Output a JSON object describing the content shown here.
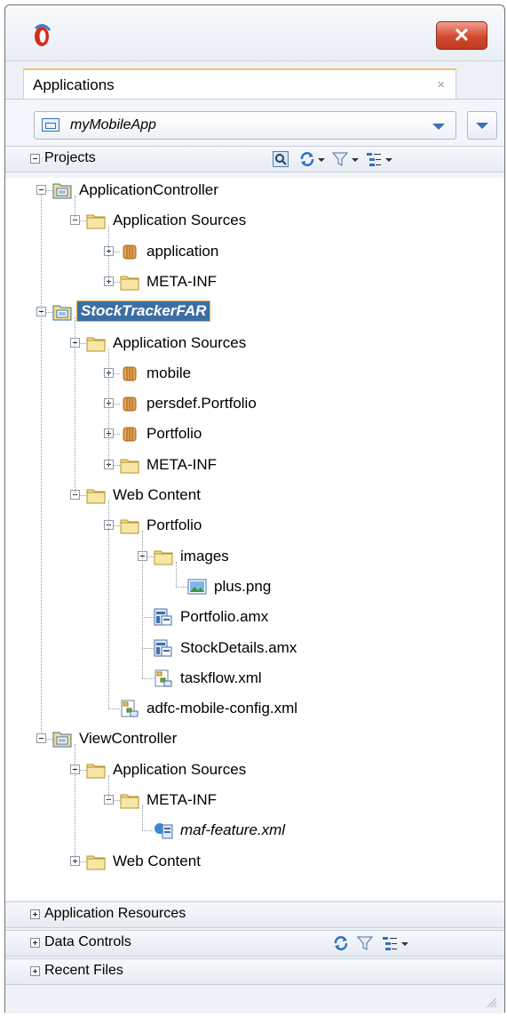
{
  "window": {
    "close_label": "✕"
  },
  "tab": {
    "label": "Applications",
    "close": "×"
  },
  "app_selector": {
    "value": "myMobileApp"
  },
  "sections": {
    "projects": "Projects",
    "application_resources": "Application Resources",
    "data_controls": "Data Controls",
    "recent_files": "Recent Files"
  },
  "tree": [
    {
      "label": "ApplicationController",
      "depth": 0,
      "icon": "project-icon",
      "expander": "minus"
    },
    {
      "label": "Application Sources",
      "depth": 1,
      "icon": "folder-icon",
      "expander": "minus"
    },
    {
      "label": "application",
      "depth": 2,
      "icon": "package-icon",
      "expander": "plus"
    },
    {
      "label": "META-INF",
      "depth": 2,
      "icon": "folder-icon",
      "expander": "plus"
    },
    {
      "label": "StockTrackerFAR",
      "depth": 0,
      "icon": "project-icon",
      "expander": "minus",
      "selected": true
    },
    {
      "label": "Application Sources",
      "depth": 1,
      "icon": "folder-icon",
      "expander": "minus"
    },
    {
      "label": "mobile",
      "depth": 2,
      "icon": "package-icon",
      "expander": "plus"
    },
    {
      "label": "persdef.Portfolio",
      "depth": 2,
      "icon": "package-icon",
      "expander": "plus"
    },
    {
      "label": "Portfolio",
      "depth": 2,
      "icon": "package-icon",
      "expander": "plus"
    },
    {
      "label": "META-INF",
      "depth": 2,
      "icon": "folder-icon",
      "expander": "plus"
    },
    {
      "label": "Web Content",
      "depth": 1,
      "icon": "folder-icon",
      "expander": "minus"
    },
    {
      "label": "Portfolio",
      "depth": 2,
      "icon": "folder-icon",
      "expander": "minus"
    },
    {
      "label": "images",
      "depth": 3,
      "icon": "folder-icon",
      "expander": "minus"
    },
    {
      "label": "plus.png",
      "depth": 4,
      "icon": "image-file-icon",
      "expander": "none"
    },
    {
      "label": "Portfolio.amx",
      "depth": 3,
      "icon": "amx-file-icon",
      "expander": "none"
    },
    {
      "label": "StockDetails.amx",
      "depth": 3,
      "icon": "amx-file-icon",
      "expander": "none"
    },
    {
      "label": "taskflow.xml",
      "depth": 3,
      "icon": "taskflow-file-icon",
      "expander": "none"
    },
    {
      "label": "adfc-mobile-config.xml",
      "depth": 2,
      "icon": "taskflow-file-icon",
      "expander": "none"
    },
    {
      "label": "ViewController",
      "depth": 0,
      "icon": "project-icon",
      "expander": "minus"
    },
    {
      "label": "Application Sources",
      "depth": 1,
      "icon": "folder-icon",
      "expander": "minus"
    },
    {
      "label": "META-INF",
      "depth": 2,
      "icon": "folder-icon",
      "expander": "minus"
    },
    {
      "label": "maf-feature.xml",
      "depth": 3,
      "icon": "feature-file-icon",
      "expander": "none",
      "italic": true
    },
    {
      "label": "Web Content",
      "depth": 1,
      "icon": "folder-icon",
      "expander": "plus"
    }
  ],
  "colors": {
    "selection_bg": "#3b6ea5",
    "selection_border": "#f0b34b",
    "accent": "#3d6fb1"
  }
}
